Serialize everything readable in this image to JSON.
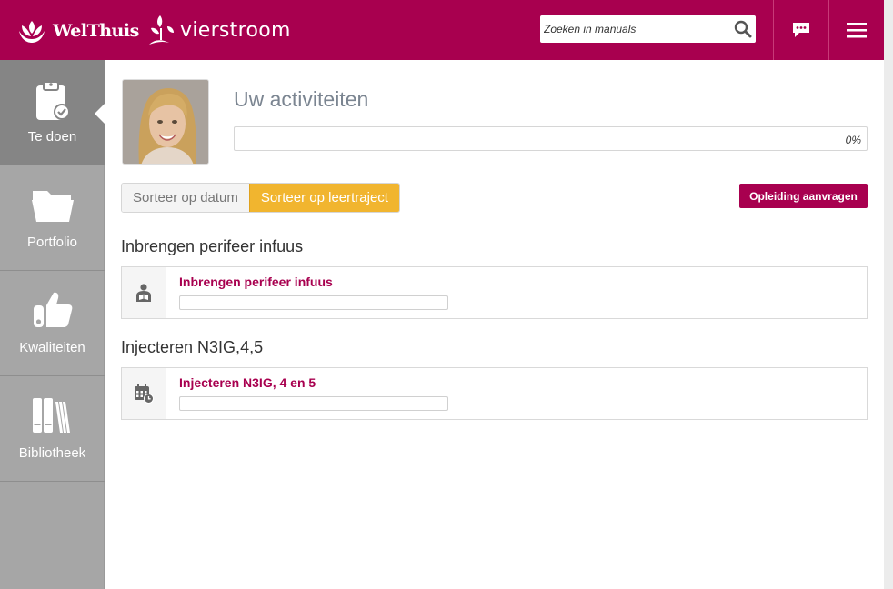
{
  "header": {
    "brand_primary": "WelThuis",
    "brand_secondary": "vierstroom",
    "search_placeholder": "Zoeken in manuals",
    "search_icon": "search-icon",
    "chat_icon": "chat-icon",
    "menu_icon": "hamburger-menu-icon",
    "bg_color": "#a8004f"
  },
  "sidebar": {
    "items": [
      {
        "label": "Te doen",
        "icon": "clipboard-check-icon",
        "active": true
      },
      {
        "label": "Portfolio",
        "icon": "folder-icon",
        "active": false
      },
      {
        "label": "Kwaliteiten",
        "icon": "thumbs-up-icon",
        "active": false
      },
      {
        "label": "Bibliotheek",
        "icon": "books-icon",
        "active": false
      }
    ]
  },
  "main": {
    "title": "Uw activiteiten",
    "progress": {
      "value": 0,
      "label": "0%"
    },
    "sort": {
      "by_date": "Sorteer op datum",
      "by_track": "Sorteer op leertraject",
      "selected": "by_track"
    },
    "request_button": "Opleiding aanvragen",
    "sections": [
      {
        "title": "Inbrengen perifeer infuus",
        "activity": {
          "title": "Inbrengen perifeer infuus",
          "icon": "person-reading-icon",
          "progress": 0
        }
      },
      {
        "title": "Injecteren N3IG,4,5",
        "activity": {
          "title": "Injecteren N3IG, 4 en 5",
          "icon": "calendar-clock-icon",
          "progress": 0
        }
      }
    ]
  },
  "colors": {
    "brand": "#a8004f",
    "sort_active": "#f1b52f",
    "sidebar": "#a6a6a6",
    "sidebar_active": "#858585"
  }
}
